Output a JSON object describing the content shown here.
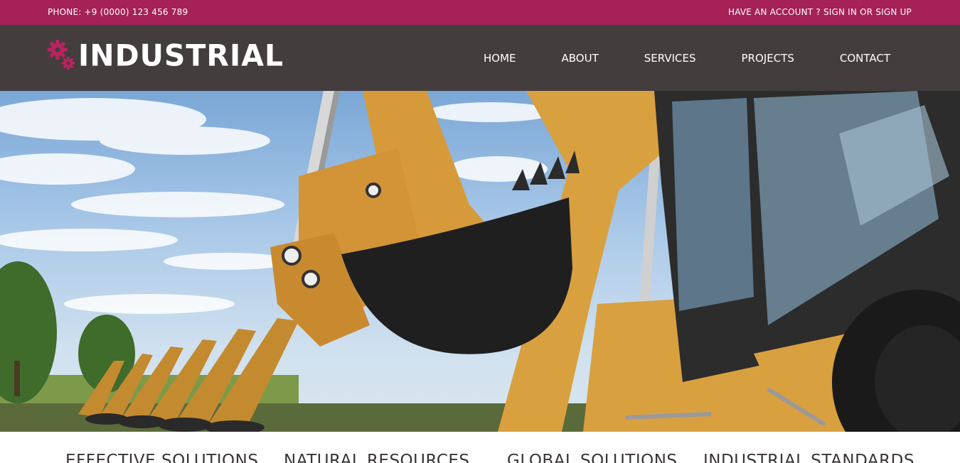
{
  "topbar": {
    "phone": "PHONE: +9 (0000) 123 456 789",
    "account_prefix": "HAVE AN ACCOUNT ? ",
    "sign_in": "SIGN IN",
    "or": " OR ",
    "sign_up": "SIGN UP"
  },
  "header": {
    "logo_text": "INDUSTRIAL",
    "nav": [
      {
        "label": "HOME"
      },
      {
        "label": "ABOUT"
      },
      {
        "label": "SERVICES"
      },
      {
        "label": "PROJECTS"
      },
      {
        "label": "CONTACT"
      }
    ]
  },
  "hero": {
    "image_subject": "row of yellow backhoe loaders"
  },
  "features": [
    {
      "label": "EFFECTIVE SOLUTIONS"
    },
    {
      "label": "NATURAL RESOURCES"
    },
    {
      "label": "GLOBAL SOLUTIONS"
    },
    {
      "label": "INDUSTRIAL STANDARDS"
    }
  ],
  "colors": {
    "topbar": "#a52157",
    "header": "#433d3e",
    "accent": "#b8245f",
    "machine_yellow": "#d79a3a"
  }
}
